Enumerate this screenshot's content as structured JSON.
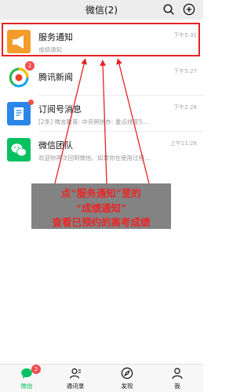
{
  "header": {
    "title": "微信(2)",
    "search_icon": "search-icon",
    "add_icon": "add-circle-icon"
  },
  "chats": [
    {
      "name": "服务通知",
      "preview": "成绩通知",
      "time": "下午5:31",
      "avatar_icon": "megaphone-icon",
      "avatar_color": "#f39b2b",
      "badge": "",
      "dot": false
    },
    {
      "name": "腾讯新闻",
      "preview": "",
      "time": "下午5:27",
      "avatar_icon": "tencent-news-icon",
      "avatar_color": "#ffffff",
      "badge": "2",
      "dot": false
    },
    {
      "name": "订阅号消息",
      "preview": "[2条] 微言教育: 中央网信办: 重点排查5...",
      "time": "下午2:28",
      "avatar_icon": "document-icon",
      "avatar_color": "#2c86e8",
      "badge": "",
      "dot": true
    },
    {
      "name": "微信团队",
      "preview": "欢迎你再次回到微信。如果你在使用过程...",
      "time": "上午11:28",
      "avatar_icon": "wechat-icon",
      "avatar_color": "#07c160",
      "badge": "",
      "dot": false
    }
  ],
  "annotation": {
    "line1": "点“服务通知”里的",
    "line2": "“成绩通知”",
    "line3": "查看已预约的高考成绩",
    "color": "#e81c1c"
  },
  "tabbar": {
    "tabs": [
      {
        "label": "微信",
        "icon": "chat-bubble-icon",
        "active": true,
        "badge": "2"
      },
      {
        "label": "通讯录",
        "icon": "contacts-icon",
        "active": false,
        "badge": ""
      },
      {
        "label": "发现",
        "icon": "compass-icon",
        "active": false,
        "badge": ""
      },
      {
        "label": "我",
        "icon": "person-icon",
        "active": false,
        "badge": ""
      }
    ],
    "accent": "#07c160"
  }
}
